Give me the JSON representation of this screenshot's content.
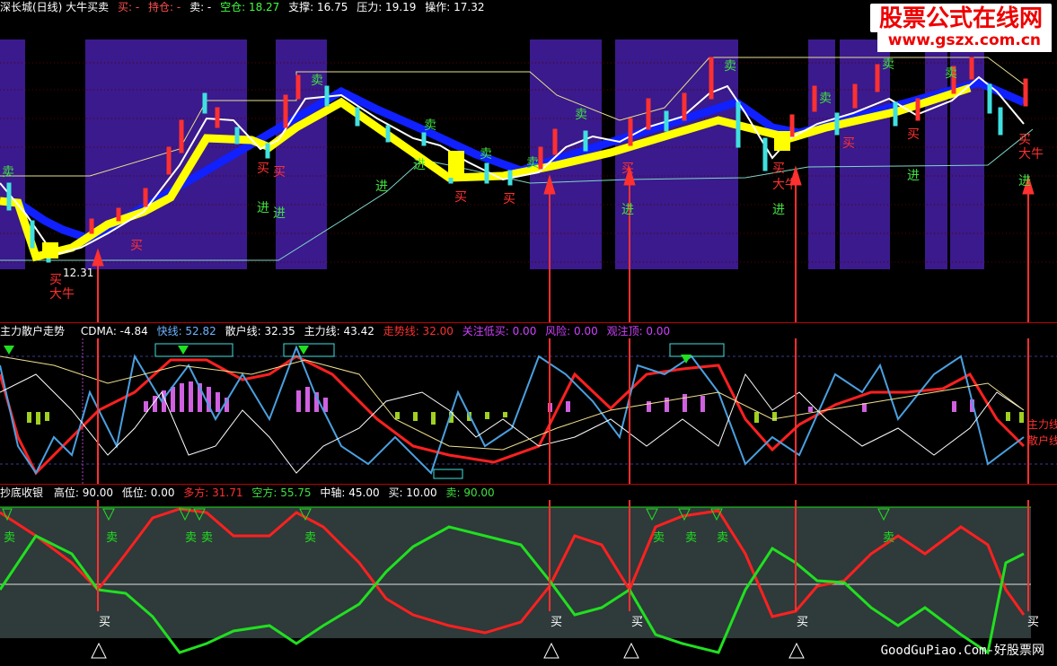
{
  "main_header": {
    "title": "深长城(日线) 大牛买卖",
    "buy": "买: -",
    "hold": "持仓: -",
    "sell": "卖: -",
    "empty": "空仓: 18.27",
    "support": "支撑: 16.75",
    "pressure": "压力: 19.19",
    "operate": "操作: 17.32"
  },
  "watermark": {
    "line1": "股票公式在线网",
    "line2": "www.gszx.com.cn",
    "bottom": "GoodGuPiao.Com-好股票网"
  },
  "main_labels": {
    "sell": "卖",
    "buy": "买",
    "enter": "进",
    "bull": "大牛",
    "low_price": "12.31"
  },
  "panel2_header": {
    "name": "主力散户走势",
    "cdma": "CDMA: -4.84",
    "fast": "快线: 52.82",
    "retail": "散户线: 32.35",
    "main": "主力线: 43.42",
    "trend": "走势线: 32.00",
    "focus": "关注低买: 0.00",
    "risk": "风险: 0.00",
    "top": "观注顶: 0.00",
    "side1": "主力线",
    "side2": "散户线"
  },
  "panel3_header": {
    "name": "抄底收银",
    "high": "高位: 90.00",
    "low": "低位: 0.00",
    "long": "多方: 31.71",
    "short": "空方: 55.75",
    "mid": "中轴: 45.00",
    "buy": "买: 10.00",
    "sell": "卖: 90.00"
  },
  "panel3_labels": {
    "sell": "卖",
    "buy": "买"
  },
  "colors": {
    "bull_bg": "#3a1a8c",
    "up": "#ff3030",
    "down": "#40e0e0",
    "yellow": "#ffff00",
    "blue": "#1020ff",
    "red_line": "#ff2020",
    "green_line": "#20e020",
    "arrow": "#ff3030"
  }
}
